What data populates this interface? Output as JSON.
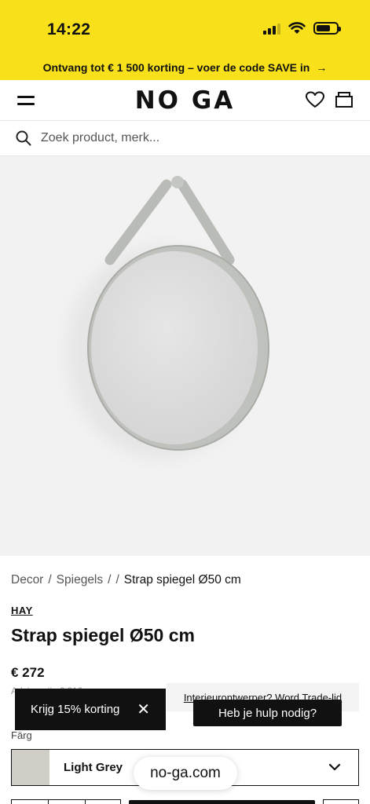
{
  "status_bar": {
    "time": "14:22"
  },
  "promo": {
    "text": "Ontvang tot € 1 500 korting – voer de code SAVE in",
    "arrow": "→"
  },
  "header": {
    "logo": "NO GA"
  },
  "search": {
    "placeholder": "Zoek product, merk..."
  },
  "breadcrumb": {
    "items": [
      "Decor",
      "/",
      "Spiegels",
      "/",
      "/"
    ],
    "current": "Strap spiegel Ø50 cm"
  },
  "product": {
    "brand": "HAY",
    "title": "Strap spiegel Ø50 cm",
    "price": "€ 272",
    "price_sub": "Adviesprijs € 319"
  },
  "trade_banner": {
    "text": "Interieurontwerper? Word Trade-lid"
  },
  "discount_popup": {
    "label": "Krijg 15% korting",
    "close": "✕"
  },
  "help_button": {
    "label": "Heb je hulp nodig?"
  },
  "color": {
    "label": "Färg",
    "selected": "Light Grey",
    "swatch": "#d1cec8"
  },
  "url_pill": {
    "text": "no-ga.com"
  },
  "colors": {
    "banner": "#f8e11a",
    "dark": "#111111",
    "image_bg": "#f2f2f2"
  }
}
